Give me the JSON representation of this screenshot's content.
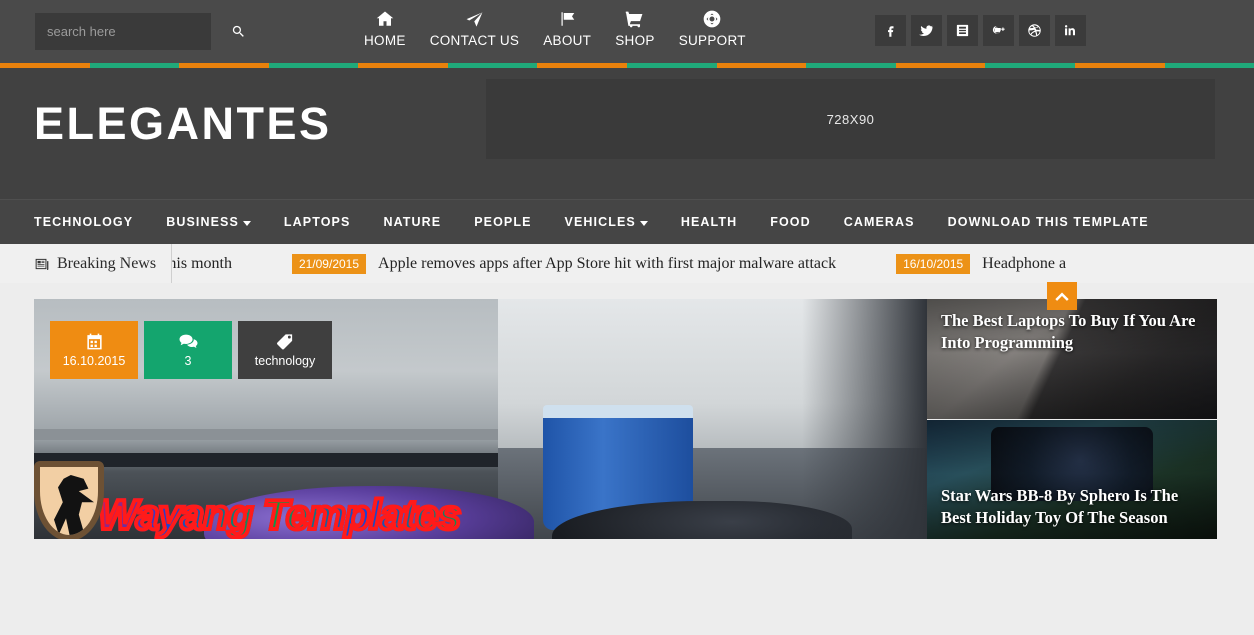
{
  "search": {
    "placeholder": "search here",
    "value": "",
    "icon": "search-icon"
  },
  "topnav": [
    {
      "label": "HOME",
      "icon": "home-icon"
    },
    {
      "label": "CONTACT US",
      "icon": "paper-plane-icon"
    },
    {
      "label": "ABOUT",
      "icon": "flag-icon"
    },
    {
      "label": "SHOP",
      "icon": "shopping-cart-icon"
    },
    {
      "label": "SUPPORT",
      "icon": "life-ring-icon"
    }
  ],
  "social": [
    {
      "name": "facebook-icon",
      "label": "Facebook"
    },
    {
      "name": "twitter-icon",
      "label": "Twitter"
    },
    {
      "name": "youtube-icon",
      "label": "YouTube"
    },
    {
      "name": "google-plus-icon",
      "label": "Google Plus"
    },
    {
      "name": "dribbble-icon",
      "label": "Dribbble"
    },
    {
      "name": "linkedin-icon",
      "label": "LinkedIn"
    }
  ],
  "brand": {
    "logo_text": "ELEGANTES"
  },
  "ad": {
    "label": "728X90"
  },
  "catnav": [
    {
      "label": "TECHNOLOGY",
      "has_dropdown": false
    },
    {
      "label": "BUSINESS",
      "has_dropdown": true
    },
    {
      "label": "LAPTOPS",
      "has_dropdown": false
    },
    {
      "label": "NATURE",
      "has_dropdown": false
    },
    {
      "label": "PEOPLE",
      "has_dropdown": false
    },
    {
      "label": "VEHICLES",
      "has_dropdown": true
    },
    {
      "label": "HEALTH",
      "has_dropdown": false
    },
    {
      "label": "FOOD",
      "has_dropdown": false
    },
    {
      "label": "CAMERAS",
      "has_dropdown": false
    },
    {
      "label": "DOWNLOAD THIS TEMPLATE",
      "has_dropdown": false
    }
  ],
  "ticker": {
    "heading": "Breaking News",
    "heading_icon": "newspaper-icon",
    "items": [
      {
        "date": "",
        "title": "aromecast this month"
      },
      {
        "date": "21/09/2015",
        "title": "Apple removes apps after App Store hit with first major malware attack"
      },
      {
        "date": "16/10/2015",
        "title": "Headphone a"
      }
    ]
  },
  "feature": {
    "badges": {
      "date": {
        "value": "16.10.2015",
        "icon": "calendar-icon"
      },
      "comments": {
        "value": "3",
        "icon": "comments-icon"
      },
      "tag": {
        "value": "technology",
        "icon": "tag-icon"
      }
    }
  },
  "right_posts": [
    {
      "title": "The Best Laptops To Buy If You Are Into Programming"
    },
    {
      "title": "Star Wars BB-8 By Sphero Is The Best Holiday Toy Of The Season"
    }
  ],
  "scroll_top": {
    "icon": "chevron-up-icon",
    "label": "Scroll to top"
  },
  "watermark": {
    "text": "Wayang Templates",
    "icon": "wayang-shield-icon"
  },
  "colors": {
    "topbar_bg": "#4a4a4a",
    "band_bg": "#414141",
    "catnav_bg": "#454545",
    "page_bg": "#ededed",
    "ticker_bg": "#f0f0f0",
    "accent_orange": "#ef8c12",
    "accent_green": "#14a56e",
    "badge_tag_bg": "#3f3f3f"
  },
  "stripe": [
    "#e8810c",
    "#20a97a",
    "#e8810c",
    "#20a97a",
    "#e8810c",
    "#20a97a",
    "#e8810c",
    "#20a97a",
    "#e8810c",
    "#20a97a",
    "#e8810c",
    "#20a97a",
    "#e8810c",
    "#20a97a"
  ]
}
